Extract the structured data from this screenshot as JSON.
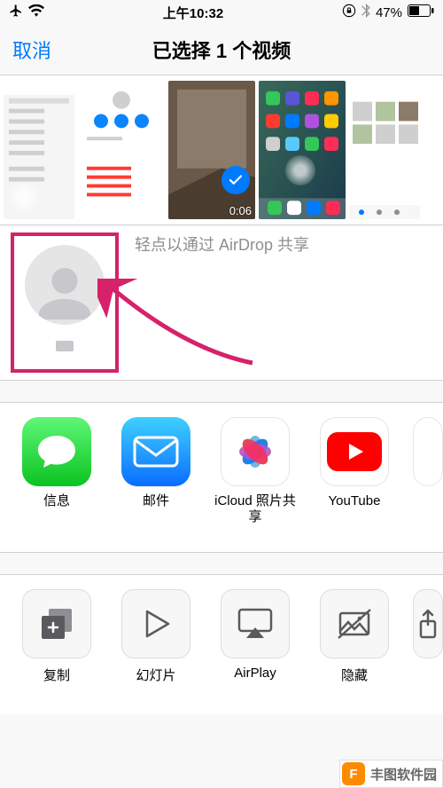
{
  "status": {
    "time": "上午10:32",
    "battery": "47%"
  },
  "nav": {
    "cancel": "取消",
    "title": "已选择 1 个视频"
  },
  "thumbs": {
    "video_duration": "0:06"
  },
  "airdrop": {
    "hint": "轻点以通过 AirDrop 共享"
  },
  "apps": {
    "messages": "信息",
    "mail": "邮件",
    "icloud": "iCloud 照片共\n享",
    "youtube": "YouTube"
  },
  "actions": {
    "copy": "复制",
    "slideshow": "幻灯片",
    "airplay": "AirPlay",
    "hide": "隐藏"
  },
  "watermark": {
    "text": "丰图软件园",
    "logo": "F"
  }
}
